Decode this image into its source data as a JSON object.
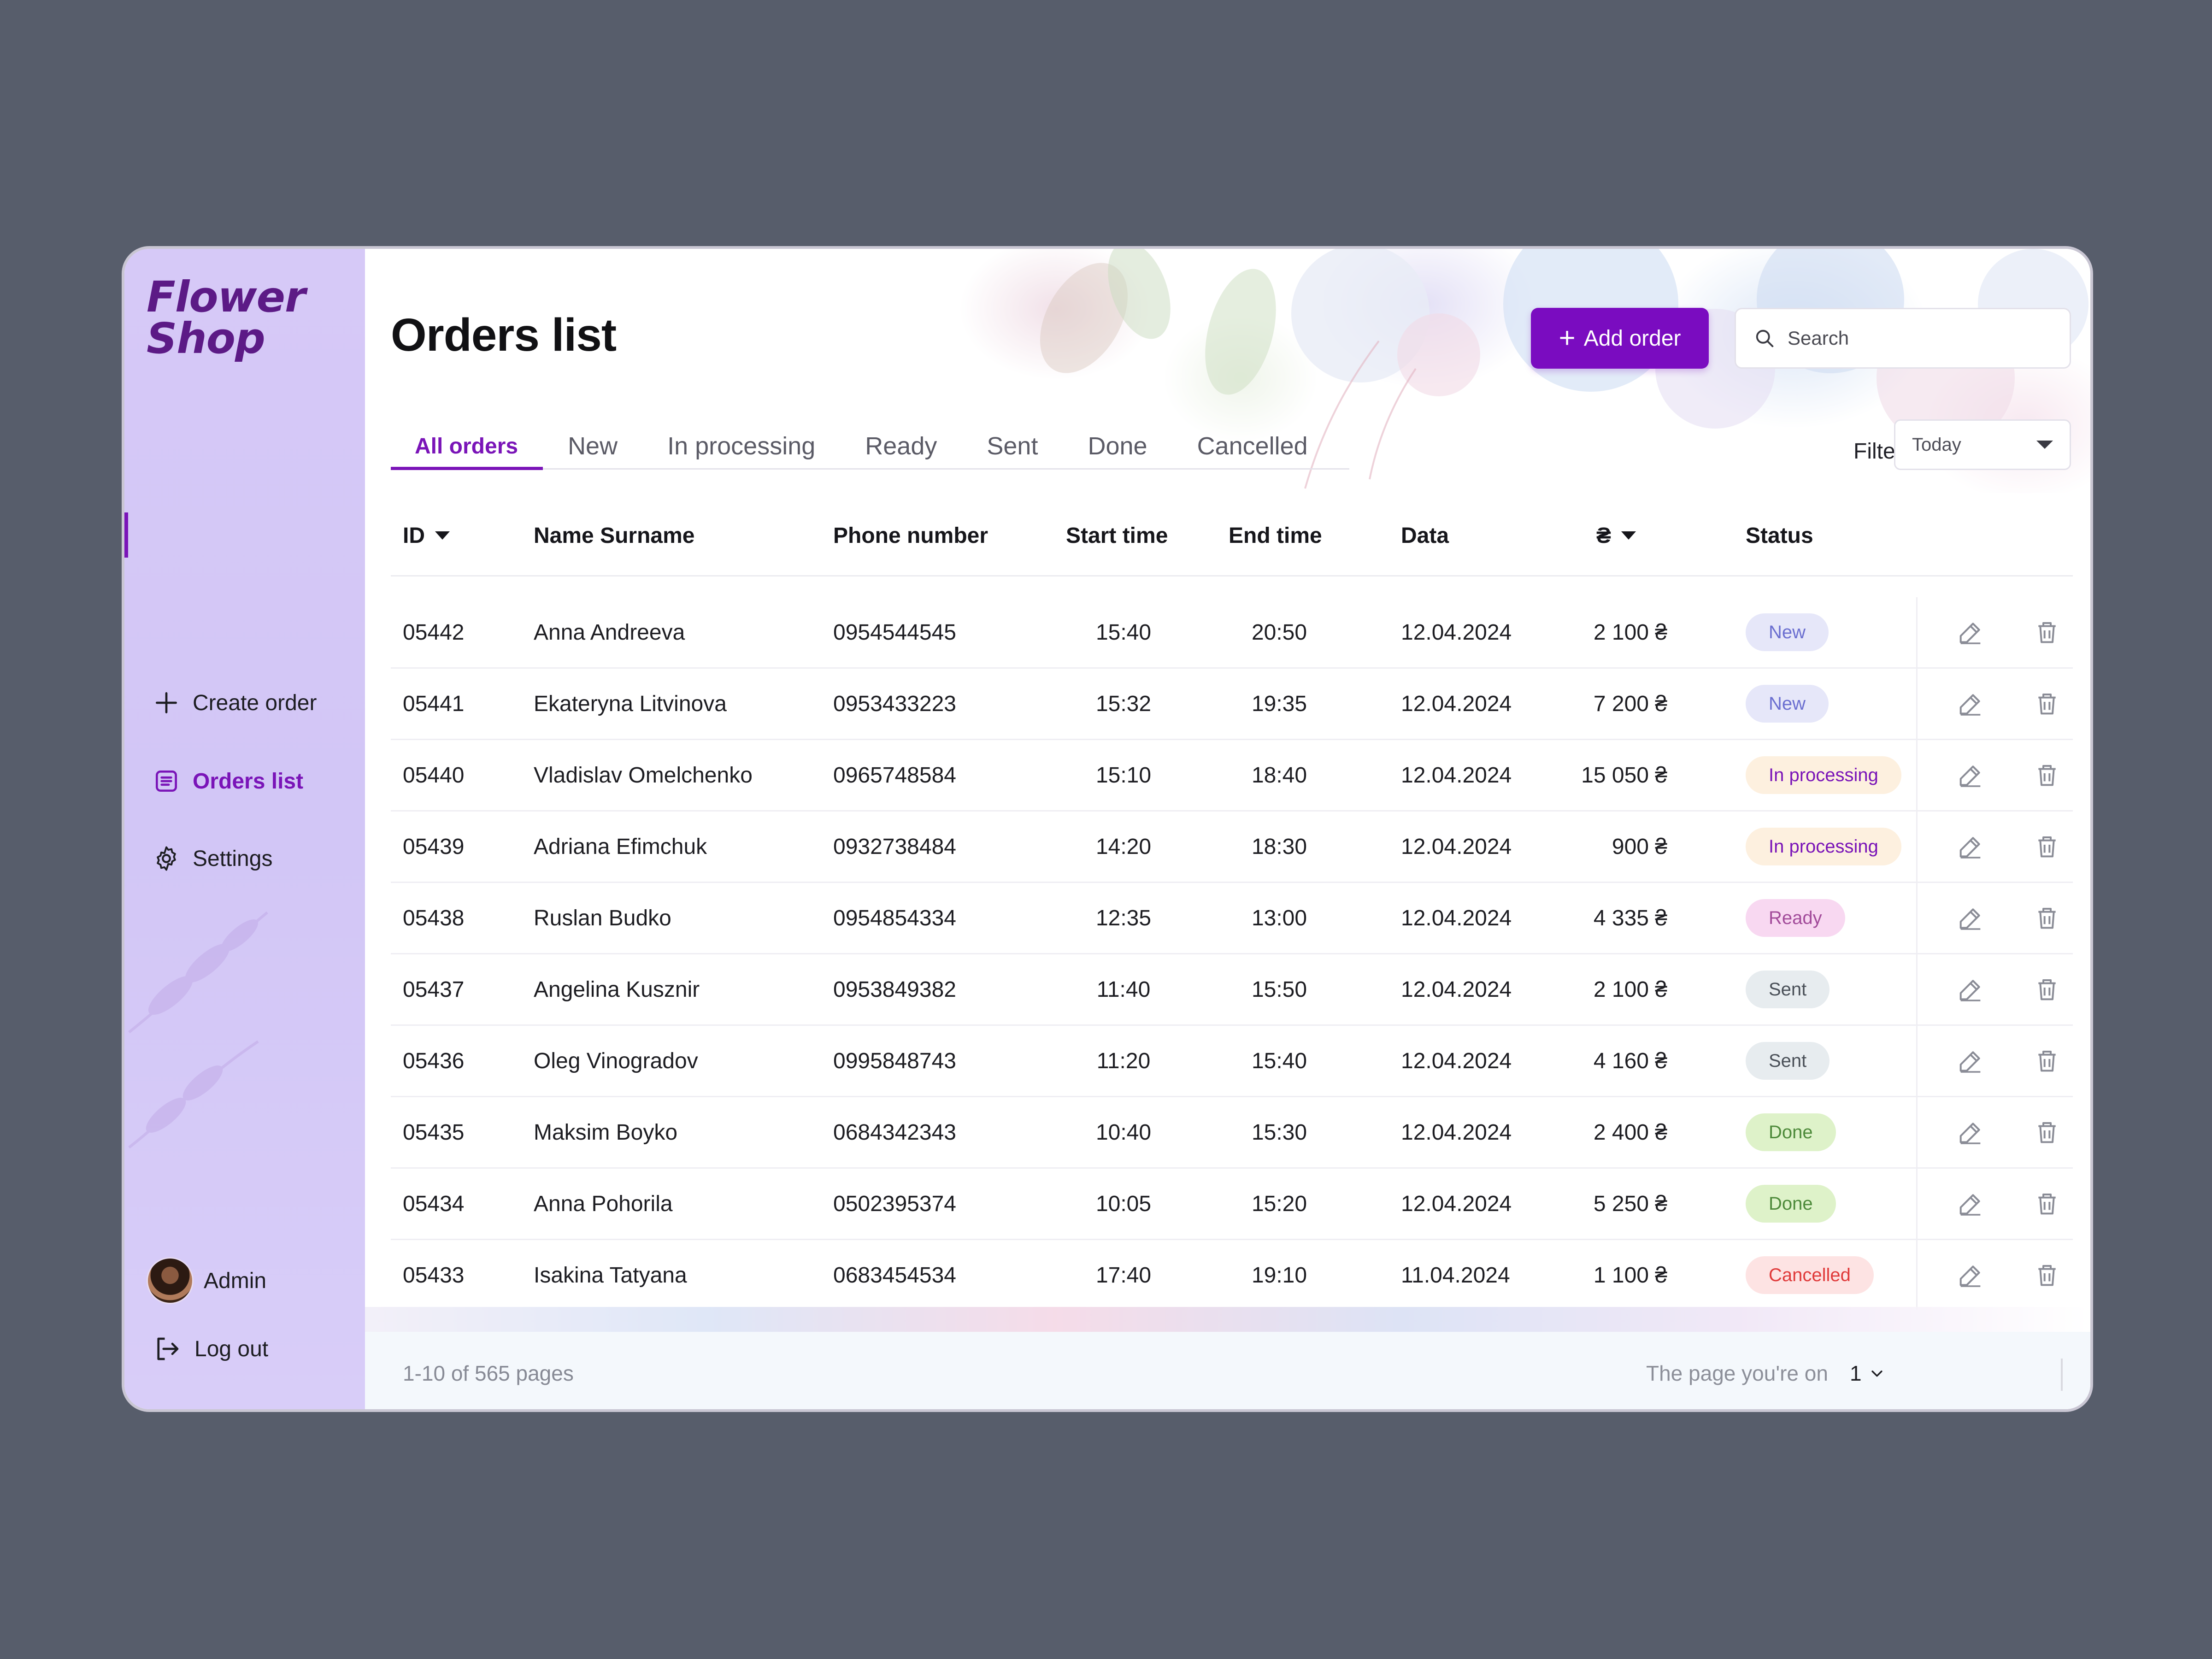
{
  "brand": {
    "line1": "Flower",
    "line2": "Shop"
  },
  "sidebar": {
    "items": [
      {
        "label": "Create order",
        "icon": "plus-icon"
      },
      {
        "label": "Orders list",
        "icon": "list-icon",
        "active": true
      },
      {
        "label": "Settings",
        "icon": "gear-icon"
      }
    ],
    "user": {
      "name": "Admin"
    },
    "logout": {
      "label": "Log out",
      "icon": "logout-icon"
    }
  },
  "page": {
    "title": "Orders list",
    "add_button": "Add order",
    "search_placeholder": "Search",
    "tabs": [
      "All orders",
      "New",
      "In processing",
      "Ready",
      "Sent",
      "Done",
      "Cancelled"
    ],
    "active_tab": "All orders",
    "date_filter": {
      "label": "Filter by date:",
      "value": "Today"
    }
  },
  "table": {
    "headers": {
      "id": "ID",
      "name": "Name Surname",
      "phone": "Phone number",
      "start": "Start time",
      "end": "End time",
      "date": "Data",
      "price": "₴",
      "status": "Status"
    },
    "rows": [
      {
        "id": "05442",
        "name": "Anna Andreeva",
        "phone": "0954544545",
        "start": "15:40",
        "end": "20:50",
        "date": "12.04.2024",
        "price": "2 100 ₴",
        "status": "New"
      },
      {
        "id": "05441",
        "name": "Ekateryna Litvinova",
        "phone": "0953433223",
        "start": "15:32",
        "end": "19:35",
        "date": "12.04.2024",
        "price": "7 200 ₴",
        "status": "New"
      },
      {
        "id": "05440",
        "name": "Vladislav Omelchenko",
        "phone": "0965748584",
        "start": "15:10",
        "end": "18:40",
        "date": "12.04.2024",
        "price": "15 050 ₴",
        "status": "In processing"
      },
      {
        "id": "05439",
        "name": "Adriana Efimchuk",
        "phone": "0932738484",
        "start": "14:20",
        "end": "18:30",
        "date": "12.04.2024",
        "price": "900 ₴",
        "status": "In processing"
      },
      {
        "id": "05438",
        "name": "Ruslan Budko",
        "phone": "0954854334",
        "start": "12:35",
        "end": "13:00",
        "date": "12.04.2024",
        "price": "4 335 ₴",
        "status": "Ready"
      },
      {
        "id": "05437",
        "name": "Angelina Kusznir",
        "phone": "0953849382",
        "start": "11:40",
        "end": "15:50",
        "date": "12.04.2024",
        "price": "2 100 ₴",
        "status": "Sent"
      },
      {
        "id": "05436",
        "name": "Oleg Vinogradov",
        "phone": "0995848743",
        "start": "11:20",
        "end": "15:40",
        "date": "12.04.2024",
        "price": "4 160 ₴",
        "status": "Sent"
      },
      {
        "id": "05435",
        "name": "Maksim Boyko",
        "phone": "0684342343",
        "start": "10:40",
        "end": "15:30",
        "date": "12.04.2024",
        "price": "2 400 ₴",
        "status": "Done"
      },
      {
        "id": "05434",
        "name": "Anna Pohorila",
        "phone": "0502395374",
        "start": "10:05",
        "end": "15:20",
        "date": "12.04.2024",
        "price": "5 250 ₴",
        "status": "Done"
      },
      {
        "id": "05433",
        "name": "Isakina Tatyana",
        "phone": "0683454534",
        "start": "17:40",
        "end": "19:10",
        "date": "11.04.2024",
        "price": "1 100 ₴",
        "status": "Cancelled"
      }
    ]
  },
  "status_colors": {
    "New": {
      "bg": "#e6e7f9",
      "fg": "#6b6fd0"
    },
    "In processing": {
      "bg": "#fdf0df",
      "fg": "#7a14b8"
    },
    "Ready": {
      "bg": "#f8d8f1",
      "fg": "#a24b9a"
    },
    "Sent": {
      "bg": "#e7ecef",
      "fg": "#4a5058"
    },
    "Done": {
      "bg": "#def2c9",
      "fg": "#4d8a3a"
    },
    "Cancelled": {
      "bg": "#fde3e3",
      "fg": "#e03a3a"
    }
  },
  "pagination": {
    "info": "1-10 of 565 pages",
    "page_label": "The page you're on",
    "current_page": "1"
  },
  "colors": {
    "accent": "#7a14b8",
    "button": "#7a0cc0",
    "sidebar": "#d4c8f7"
  }
}
